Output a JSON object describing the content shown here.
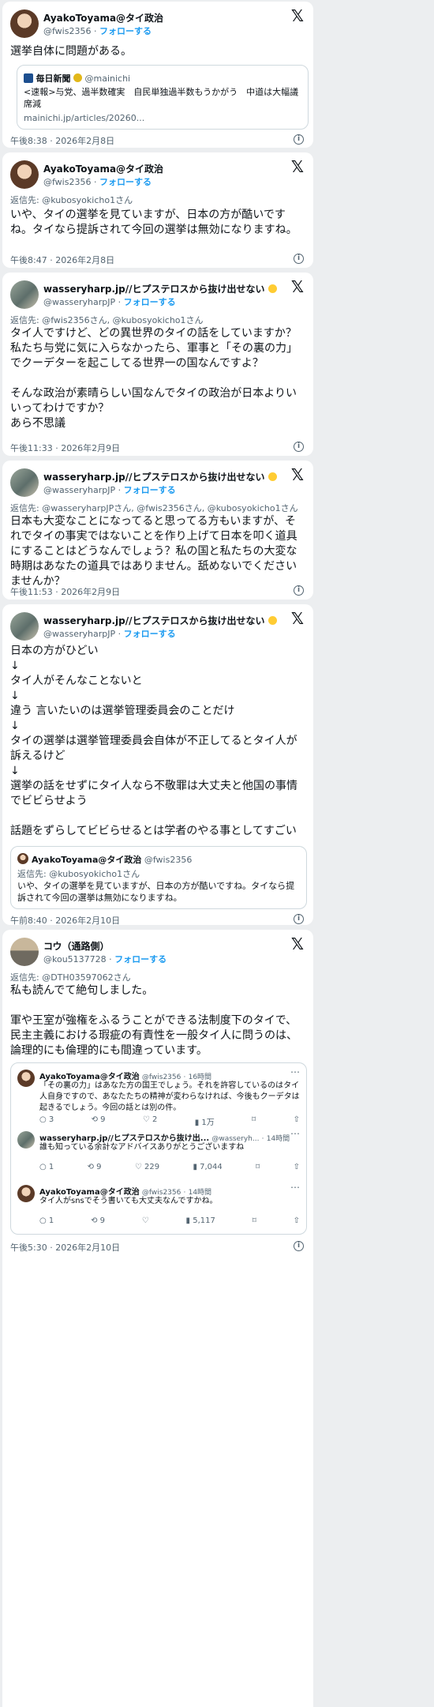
{
  "x_logo": "𝕏",
  "info_icon": "i",
  "follow_label": "フォローする",
  "posts": [
    {
      "name": "AyakoToyama@タイ政治",
      "handle": "@fwis2356",
      "text": "選挙自体に問題がある。",
      "link_card": {
        "source": "毎日新聞",
        "source_handle": "@mainichi",
        "title": "<速報>与党、過半数確実　自民単独過半数もうかがう　中道は大幅議席減",
        "url": "mainichi.jp/articles/20260..."
      },
      "time": "午後8:38 · 2026年2月8日"
    },
    {
      "name": "AyakoToyama@タイ政治",
      "handle": "@fwis2356",
      "reply_to": "返信先: @kubosyokicho1さん",
      "text": "いや、タイの選挙を見ていますが、日本の方が酷いですね。タイなら提訴されて今回の選挙は無効になりますね。",
      "time": "午後8:47 · 2026年2月8日"
    },
    {
      "name": "wasseryharp.jp//ヒプステロスから抜け出せない",
      "handle": "@wasseryharpJP",
      "reply_to": "返信先: @fwis2356さん, @kubosyokicho1さん",
      "text_lines": [
        "タイ人ですけど、どの異世界のタイの話をしていますか？私たち与党に気に入らなかったら、軍事と「その裏の力」でクーデターを起こしてる世界一の国なんですよ？",
        "",
        "そんな政治が素晴らしい国なんでタイの政治が日本よりいいってわけですか？",
        "あら不思議"
      ],
      "time": "午後11:33 · 2026年2月9日"
    },
    {
      "name": "wasseryharp.jp//ヒプステロスから抜け出せない",
      "handle": "@wasseryharpJP",
      "reply_to": "返信先: @wasseryharpJPさん, @fwis2356さん, @kubosyokicho1さん",
      "text": "日本も大変なことになってると思ってる方もいますが、それでタイの事実ではないことを作り上げて日本を叩く道具にすることはどうなんでしょう？私の国と私たちの大変な時期はあなたの道具ではありません。舐めないでくださいませんか？",
      "time": "午後11:53 · 2026年2月9日"
    },
    {
      "name": "wasseryharp.jp//ヒプステロスから抜け出せない",
      "handle": "@wasseryharpJP",
      "text_lines": [
        "日本の方がひどい",
        "↓",
        "タイ人がそんなことないと",
        "↓",
        "違う 言いたいのは選挙管理委員会のことだけ",
        "↓",
        "タイの選挙は選挙管理委員会自体が不正してるとタイ人が訴えるけど",
        "↓",
        "選挙の話をせずにタイ人なら不敬罪は大丈夫と他国の事情でビビらせよう",
        "",
        "話題をずらしてビビらせるとは学者のやる事としてすごい"
      ],
      "quote": {
        "name": "AyakoToyama@タイ政治",
        "handle": "@fwis2356",
        "reply_to": "返信先: @kubosyokicho1さん",
        "text": "いや、タイの選挙を見ていますが、日本の方が酷いですね。タイなら提訴されて今回の選挙は無効になりますね。"
      },
      "time": "午前8:40 · 2026年2月10日"
    },
    {
      "name": "コウ（通路側）",
      "handle": "@kou5137728",
      "reply_to": "返信先: @DTH03597062さん",
      "text_lines": [
        "私も読んでて絶句しました。",
        "",
        "軍や王室が強権をふるうことができる法制度下のタイで、民主主義における瑕疵の有責性を一般タイ人に問うのは、論理的にも倫理的にも間違っています。"
      ],
      "embedded": [
        {
          "name": "AyakoToyama@タイ政治",
          "handle": "@fwis2356",
          "age": "16時間",
          "text": "「その裏の力」はあなた方の国王でしょう。それを許容しているのはタイ人自身ですので、あなたたちの精神が変わらなければ、今後もクーデタは起きるでしょう。今回の話とは別の件。",
          "stats": [
            "3",
            "9",
            "2",
            "1万"
          ]
        },
        {
          "name": "wasseryharp.jp//ヒプステロスから抜け出...",
          "handle": "@wasseryh...",
          "age": "14時間",
          "text": "誰も知っている余計なアドバイスありがとうございますね",
          "stats": [
            "1",
            "9",
            "229",
            "7,044"
          ]
        },
        {
          "name": "AyakoToyama@タイ政治",
          "handle": "@fwis2356",
          "age": "14時間",
          "text": "タイ人がsnsでそう書いても大丈夫なんですかね。",
          "stats": [
            "1",
            "9",
            "",
            "5,117"
          ]
        }
      ],
      "time": "午後5:30 · 2026年2月10日"
    }
  ]
}
